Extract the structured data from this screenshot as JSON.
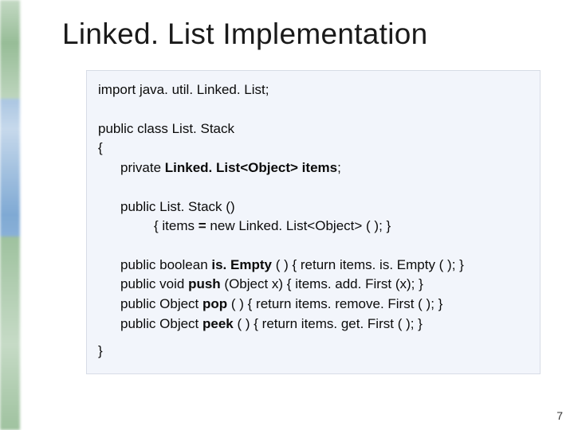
{
  "title": "Linked. List Implementation",
  "page_number": "7",
  "code": {
    "l1": "import java. util. Linked. List;",
    "l2a": "public class List. Stack",
    "l2b": "{",
    "l3a": "private ",
    "l3b": "Linked. List<Object> items",
    "l3c": ";",
    "l4": "public List. Stack ()",
    "l5a": "{  items ",
    "l5b": "= ",
    "l5c": "new Linked. List<Object> ( );  }",
    "l6a": "public boolean ",
    "l6b": "is. Empty ",
    "l6c": "( )   {  return items. is. Empty ( );  }",
    "l7a": "public void ",
    "l7b": "push ",
    "l7c": "(Object x)   {  items. add. First (x);  }",
    "l8a": "public Object ",
    "l8b": "pop ",
    "l8c": "( )   {  return items. remove. First ( );  }",
    "l9a": "public Object ",
    "l9b": "peek ",
    "l9c": "( )   {  return items. get. First ( );  }",
    "l10": "}"
  }
}
